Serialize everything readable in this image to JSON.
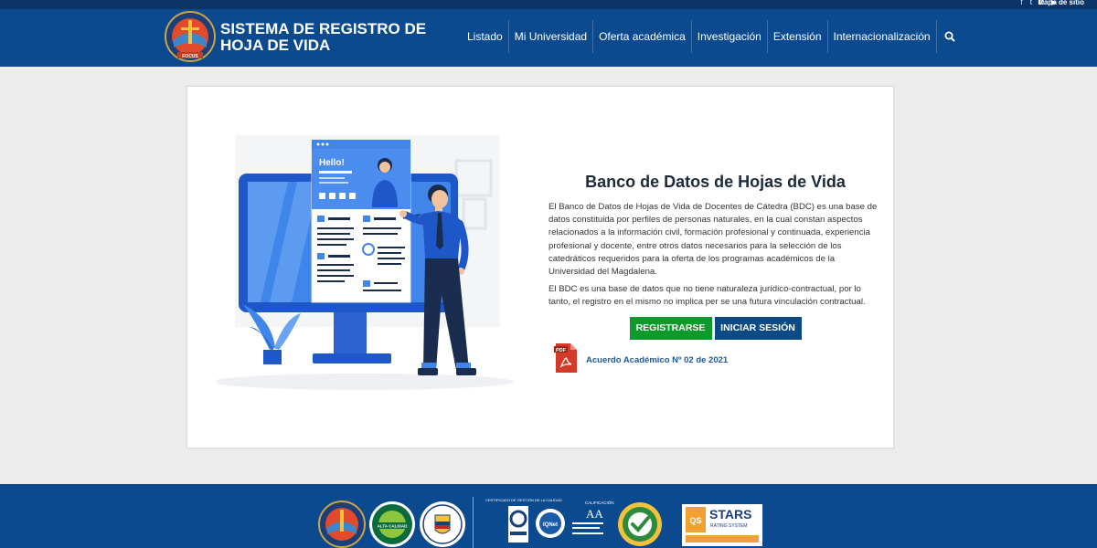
{
  "topbar": {
    "social_icons": [
      "facebook-icon",
      "twitter-icon",
      "instagram-icon",
      "youtube-icon"
    ],
    "mapa_label": "Mapa de sitio"
  },
  "header": {
    "title_line1": "SISTEMA DE REGISTRO DE",
    "title_line2": "HOJA DE VIDA",
    "logo_text": "UNIVERSIDAD DEL MAGDALENA",
    "nav": [
      "Listado",
      "Mi Universidad",
      "Oferta académica",
      "Investigación",
      "Extensión",
      "Internacionalización"
    ]
  },
  "illustration": {
    "hello_text": "Hello!"
  },
  "main": {
    "heading": "Banco de Datos de Hojas de Vida",
    "paragraph1": "El Banco de Datos de Hojas de Vida de Docentes de Cátedra (BDC) es una base de datos constituida por perfiles de personas naturales, en la cual constan aspectos relacionados a la información civil, formación profesional y continuada, experiencia profesional y docente, entre otros datos necesarios para la selección de los catedráticos requeridos para la oferta de los programas académicos de la Universidad del Magdalena.",
    "paragraph2": "El BDC es una base de datos que no tiene naturaleza jurídico-contractual, por lo tanto, el registro en el mismo no implica per se una futura vinculación contractual.",
    "register_label": "REGISTRARSE",
    "login_label": "INICIAR SESIÓN",
    "pdf_badge": "PDF",
    "pdf_link": "Acuerdo Académico Nº 02 de 2021"
  },
  "footer": {
    "seal_labels": [
      "ALTA CALIDAD",
      "REPÚBLICA DE COLOMBIA",
      "IQNet",
      "AA",
      "STARS",
      "RATING SYSTEM"
    ]
  },
  "colors": {
    "header": "#0b4a8e",
    "topbar": "#0b3566",
    "register_button": "#0c9a2a",
    "login_button": "#0c4a86"
  }
}
